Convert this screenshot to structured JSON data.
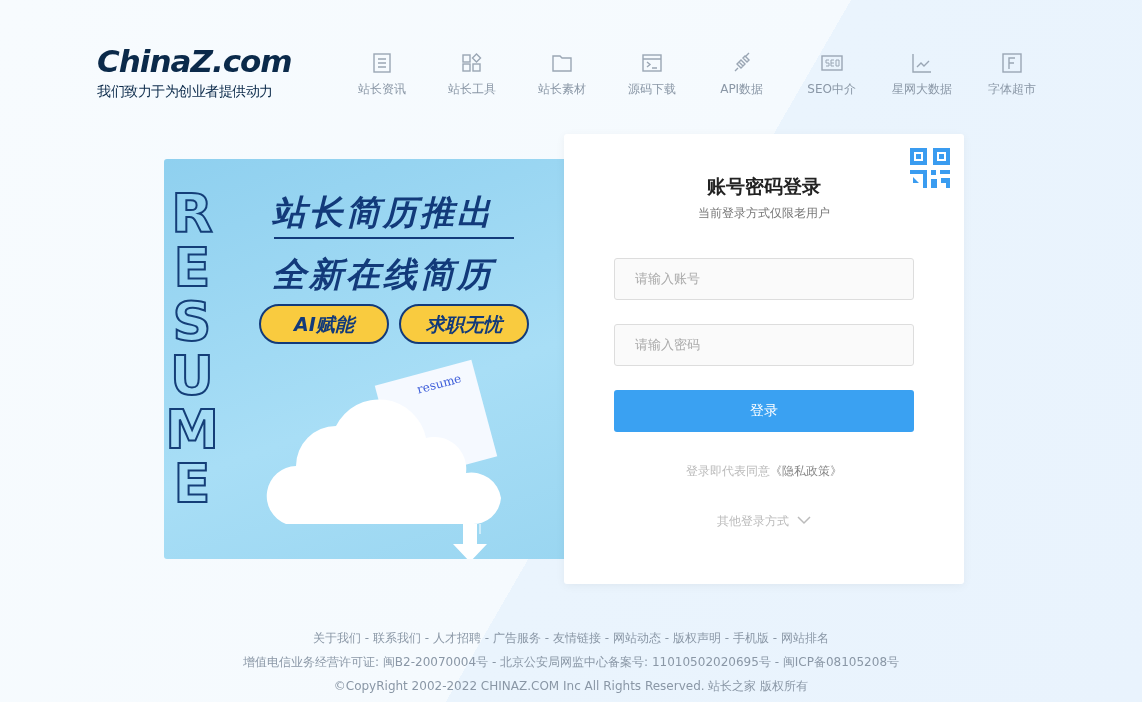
{
  "logo": {
    "brand": "ChinaZ.com",
    "slogan": "我们致力于为创业者提供动力"
  },
  "nav": [
    {
      "label": "站长资讯"
    },
    {
      "label": "站长工具"
    },
    {
      "label": "站长素材"
    },
    {
      "label": "源码下载"
    },
    {
      "label": "API数据"
    },
    {
      "label": "SEO中介"
    },
    {
      "label": "星网大数据"
    },
    {
      "label": "字体超市"
    }
  ],
  "banner": {
    "vertical_word": "RESUME",
    "headline": "站长简历推出",
    "subheadline": "全新在线简历",
    "pills": [
      "AI赋能",
      "求职无忧"
    ],
    "card_word": "resume"
  },
  "login": {
    "title": "账号密码登录",
    "subtitle": "当前登录方式仅限老用户",
    "fields": [
      {
        "placeholder": "请输入账号"
      },
      {
        "placeholder": "请输入密码"
      }
    ],
    "submit": "登录",
    "agreement": "登录即代表同意",
    "policy_link": "《隐私政策》",
    "other": "其他登录方式"
  },
  "footer": {
    "separator": "-",
    "links": [
      "关于我们",
      "联系我们",
      "人才招聘",
      "广告服务",
      "友情链接",
      "网站动态",
      "版权声明",
      "手机版",
      "网站排名"
    ],
    "license": "增值电信业务经营许可证: 闽B2-20070004号 - 北京公安局网监中心备案号: 11010502020695号 -  闽ICP备08105208号",
    "copyright": "©CopyRight 2002-2022 CHINAZ.COM Inc All Rights Reserved. 站长之家 版权所有"
  }
}
